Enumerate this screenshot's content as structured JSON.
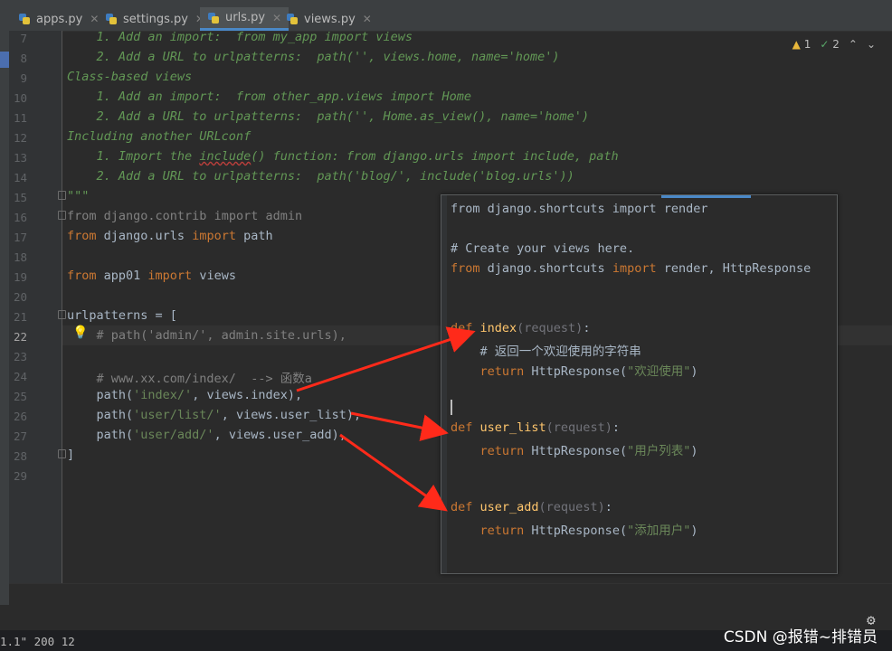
{
  "tabs": [
    {
      "label": "apps.py",
      "active": false
    },
    {
      "label": "settings.py",
      "active": false
    },
    {
      "label": "urls.py",
      "active": true
    },
    {
      "label": "views.py",
      "active": false
    }
  ],
  "inspections": {
    "warnings": "1",
    "weak_warnings": "2"
  },
  "line_numbers": [
    "7",
    "8",
    "9",
    "10",
    "11",
    "12",
    "13",
    "14",
    "15",
    "16",
    "17",
    "18",
    "19",
    "20",
    "21",
    "22",
    "23",
    "24",
    "25",
    "26",
    "27",
    "28",
    "29"
  ],
  "urls_code": {
    "l7": "    1. Add an import:  from my_app import views",
    "l8": "    2. Add a URL to urlpatterns:  path('', views.home, name='home')",
    "l9": "Class-based views",
    "l10": "    1. Add an import:  from other_app.views import Home",
    "l11": "    2. Add a URL to urlpatterns:  path('', Home.as_view(), name='home')",
    "l12": "Including another URLconf",
    "l13_a": "    1. Import the ",
    "l13_b": "include",
    "l13_c": "() function: from django.urls import include, path",
    "l14": "    2. Add a URL to urlpatterns:  path('blog/', include('blog.urls'))",
    "l15": "\"\"\"",
    "l16_kw": "from",
    "l16_rest": " django.contrib ",
    "l16_kw2": "import",
    "l16_end": " admin",
    "l17_kw": "from",
    "l17_rest": " django.urls ",
    "l17_kw2": "import",
    "l17_end": " path",
    "l19_kw": "from",
    "l19_rest": " app01 ",
    "l19_kw2": "import",
    "l19_end": " views",
    "l21": "urlpatterns = [",
    "l22": "    # path('admin/', admin.site.urls),",
    "l24": "    # www.xx.com/index/  --> 函数a",
    "l25_a": "    path(",
    "l25_s": "'index/'",
    "l25_b": ", views.index),",
    "l26_a": "    path(",
    "l26_s": "'user/list/'",
    "l26_b": ", views.user_list),",
    "l27_a": "    path(",
    "l27_s": "'user/add/'",
    "l27_b": ", views.user_add),",
    "l28": "]"
  },
  "views_popup": {
    "p1": "from django.shortcuts import render",
    "p2": "# Create your views here.",
    "p3_kw": "from",
    "p3_rest": " django.shortcuts ",
    "p3_kw2": "import",
    "p3_end": " render, HttpResponse",
    "f1_def": "def ",
    "f1_name": "index",
    "f1_par": "(request)",
    "f1_end": ":",
    "f1_cmt": "    # 返回一个欢迎使用的字符串",
    "f1_ret": "    return",
    "f1_call": " HttpResponse(",
    "f1_str": "\"欢迎使用\"",
    "f1_close": ")",
    "f2_def": "def ",
    "f2_name": "user_list",
    "f2_par": "(request)",
    "f2_end": ":",
    "f2_ret": "    return",
    "f2_call": " HttpResponse(",
    "f2_str": "\"用户列表\"",
    "f2_close": ")",
    "f3_def": "def ",
    "f3_name": "user_add",
    "f3_par": "(request)",
    "f3_end": ":",
    "f3_ret": "    return",
    "f3_call": " HttpResponse(",
    "f3_str": "\"添加用户\"",
    "f3_close": ")"
  },
  "bottom_log": "1.1\" 200 12",
  "watermark": "CSDN @报错~排错员",
  "colors": {
    "accent": "#4a88c7",
    "arrow": "#ff2a1a",
    "keyword": "#cc7832",
    "string": "#6a8759",
    "function": "#ffc66d"
  }
}
